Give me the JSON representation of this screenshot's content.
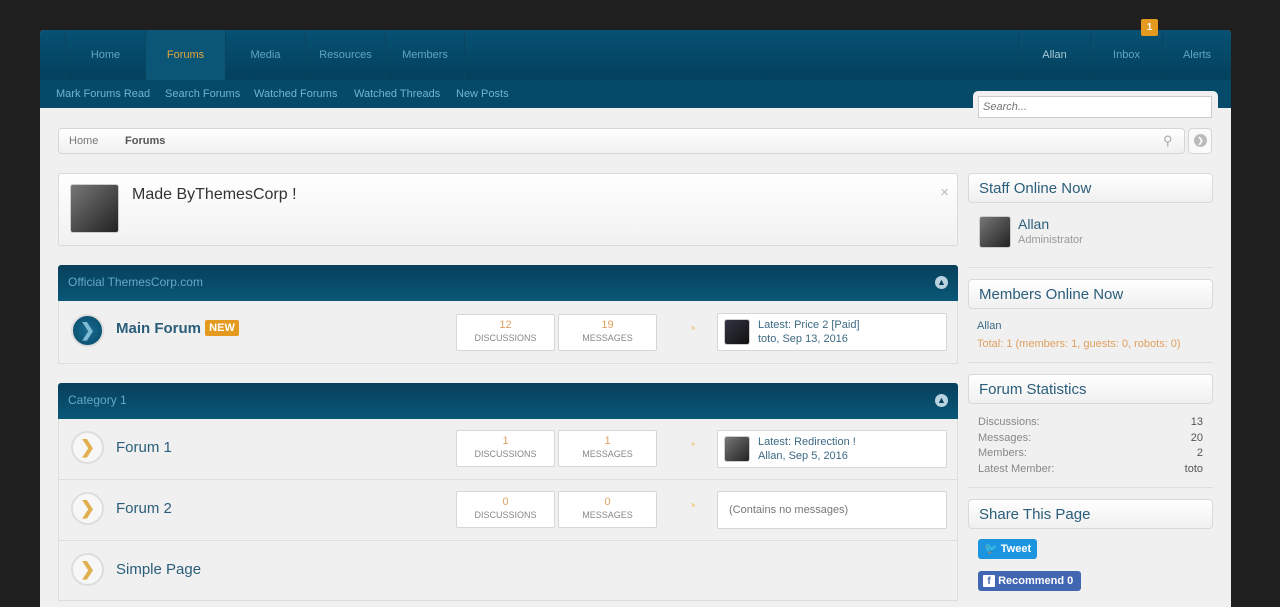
{
  "nav": {
    "tabs": [
      {
        "label": "Home"
      },
      {
        "label": "Forums"
      },
      {
        "label": "Media"
      },
      {
        "label": "Resources"
      },
      {
        "label": "Members"
      }
    ],
    "right": [
      {
        "label": "Allan"
      },
      {
        "label": "Inbox"
      },
      {
        "label": "Alerts"
      }
    ],
    "inbox_badge": "1"
  },
  "subnav": [
    "Mark Forums Read",
    "Search Forums",
    "Watched Forums",
    "Watched Threads",
    "New Posts"
  ],
  "search": {
    "placeholder": "Search..."
  },
  "breadcrumb": [
    "Home",
    "Forums"
  ],
  "notice": {
    "text": "Made ByThemesCorp !",
    "close": "×"
  },
  "categories": [
    {
      "title": "Official ThemesCorp.com",
      "forums": [
        {
          "name": "Main Forum",
          "badge": "NEW",
          "discussions": "12",
          "messages": "19",
          "latest_title": "Latest: Price 2 [Paid]",
          "latest_by": "toto",
          "latest_date": ", Sep 13, 2016"
        }
      ]
    },
    {
      "title": "Category 1",
      "forums": [
        {
          "name": "Forum 1",
          "discussions": "1",
          "messages": "1",
          "latest_title": "Latest: Redirection !",
          "latest_by": "Allan",
          "latest_date": ", Sep 5, 2016"
        },
        {
          "name": "Forum 2",
          "discussions": "0",
          "messages": "0",
          "empty": "(Contains no messages)"
        },
        {
          "name": "Simple Page"
        }
      ]
    }
  ],
  "labels": {
    "discussions": "DISCUSSIONS",
    "messages": "MESSAGES"
  },
  "sidebar": {
    "staff": {
      "title": "Staff Online Now",
      "name": "Allan",
      "role": "Administrator"
    },
    "members": {
      "title": "Members Online Now",
      "name": "Allan",
      "total": "Total: 1 (members: 1, guests: 0, robots: 0)"
    },
    "stats": {
      "title": "Forum Statistics",
      "rows": [
        {
          "label": "Discussions:",
          "value": "13"
        },
        {
          "label": "Messages:",
          "value": "20"
        },
        {
          "label": "Members:",
          "value": "2"
        },
        {
          "label": "Latest Member:",
          "value": "toto"
        }
      ]
    },
    "share": {
      "title": "Share This Page",
      "tweet": "Tweet",
      "recommend": "Recommend",
      "recommend_count": "0"
    }
  },
  "colors": {
    "accent": "#e39a1e",
    "header": "#064a69",
    "link": "#2b5e7a"
  }
}
